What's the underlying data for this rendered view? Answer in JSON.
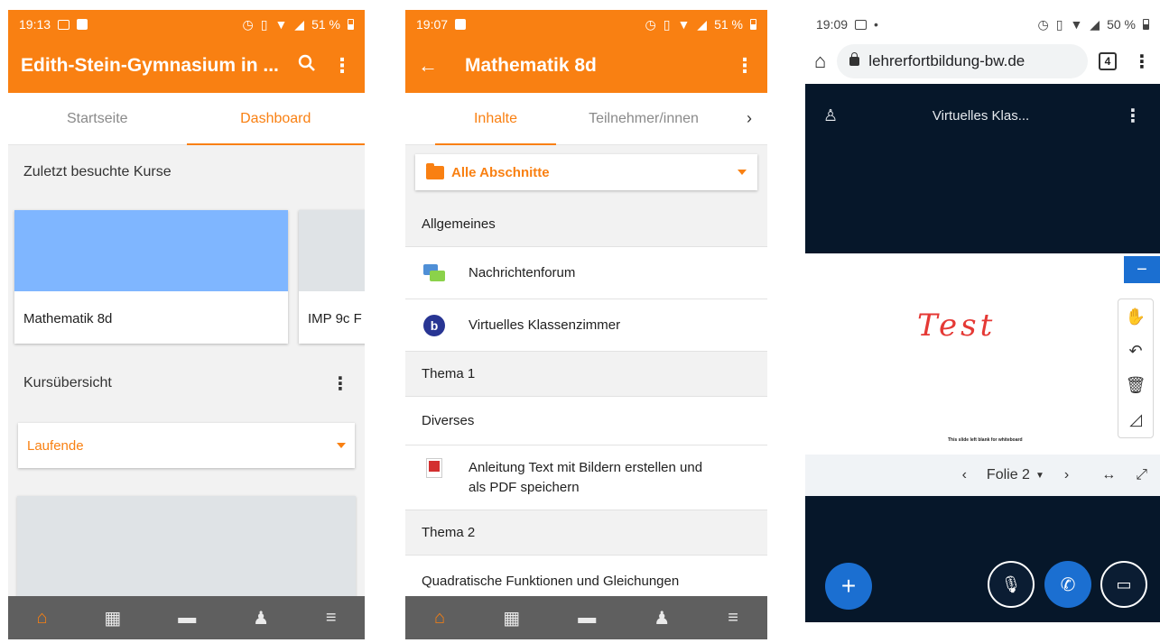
{
  "colors": {
    "moodle_orange": "#f98012",
    "bbb_dark": "#06172a",
    "bbb_blue": "#1b6fd1"
  },
  "phone1": {
    "status": {
      "time": "19:13",
      "battery": "51 %"
    },
    "appbar": {
      "title": "Edith-Stein-Gymnasium in ...",
      "search_icon": "search-icon",
      "menu_icon": "more-vert-icon"
    },
    "tabs": [
      {
        "label": "Startseite"
      },
      {
        "label": "Dashboard"
      }
    ],
    "recent": {
      "heading": "Zuletzt besuchte Kurse",
      "courses": [
        {
          "name": "Mathematik 8d",
          "color": "#7fb6ff"
        },
        {
          "name": "IMP 9c F",
          "color": "#dfe3e6"
        }
      ]
    },
    "overview": {
      "heading": "Kursübersicht",
      "filter": "Laufende"
    }
  },
  "phone2": {
    "status": {
      "time": "19:07",
      "battery": "51 %"
    },
    "appbar": {
      "title": "Mathematik 8d",
      "back_icon": "back-arrow-icon",
      "menu_icon": "more-vert-icon"
    },
    "tabs": [
      {
        "label": "Inhalte"
      },
      {
        "label": "Teilnehmer/innen"
      }
    ],
    "filter": "Alle Abschnitte",
    "sections": [
      {
        "title": "Allgemeines",
        "items": [
          {
            "icon": "forum-icon",
            "label": "Nachrichtenforum"
          },
          {
            "icon": "bigbluebutton-icon",
            "label": "Virtuelles Klassenzimmer"
          }
        ]
      },
      {
        "title": "Thema 1",
        "items": [
          {
            "icon": "",
            "label": "Diverses"
          },
          {
            "icon": "pdf-icon",
            "label_line1": "Anleitung Text mit Bildern erstellen und",
            "label_line2": "als PDF speichern"
          }
        ]
      },
      {
        "title": "Thema 2",
        "items": [
          {
            "icon": "",
            "label": "Quadratische Funktionen und Gleichungen"
          }
        ]
      }
    ]
  },
  "phone3": {
    "status": {
      "time": "19:09",
      "battery": "50 %"
    },
    "browser": {
      "url": "lehrerfortbildung-bw.de",
      "tab_count": "4"
    },
    "session": {
      "title": "Virtuelles Klas..."
    },
    "whiteboard": {
      "drawn_text": "Test",
      "note": "This slide left blank for whiteboard"
    },
    "slide_nav": {
      "label": "Folie 2"
    }
  }
}
